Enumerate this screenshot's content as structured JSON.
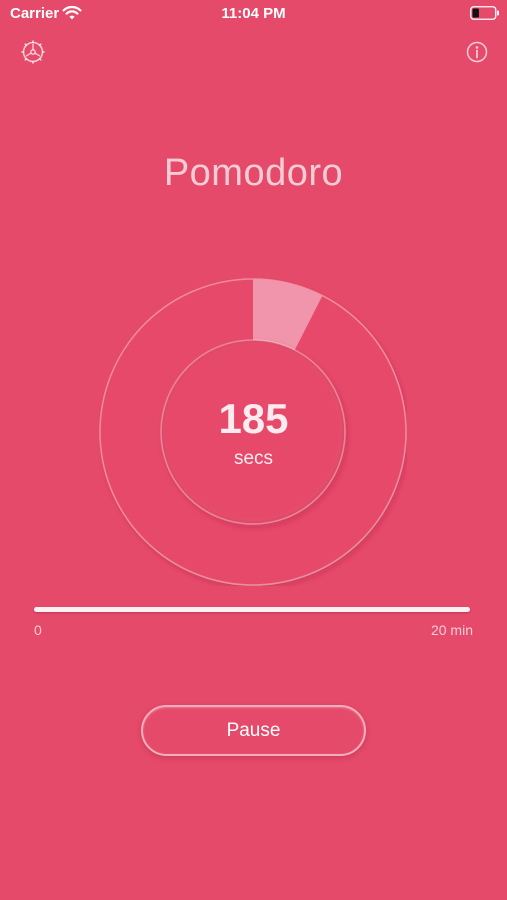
{
  "status_bar": {
    "carrier": "Carrier",
    "time": "11:04 PM",
    "wifi_icon": "wifi-icon",
    "battery_icon": "battery-icon",
    "battery_level": 0.3
  },
  "header": {
    "settings_icon": "gear-icon",
    "info_icon": "info-icon"
  },
  "title": "Pomodoro",
  "timer": {
    "value": "185",
    "unit": "secs",
    "ring_progress": 0.075
  },
  "slider": {
    "min_label": "0",
    "max_label": "20 min",
    "value_fraction": 1.0
  },
  "controls": {
    "pause_label": "Pause"
  },
  "colors": {
    "background": "#e64a6a",
    "ring_highlight": "#f095ab",
    "text": "#ffffff"
  }
}
